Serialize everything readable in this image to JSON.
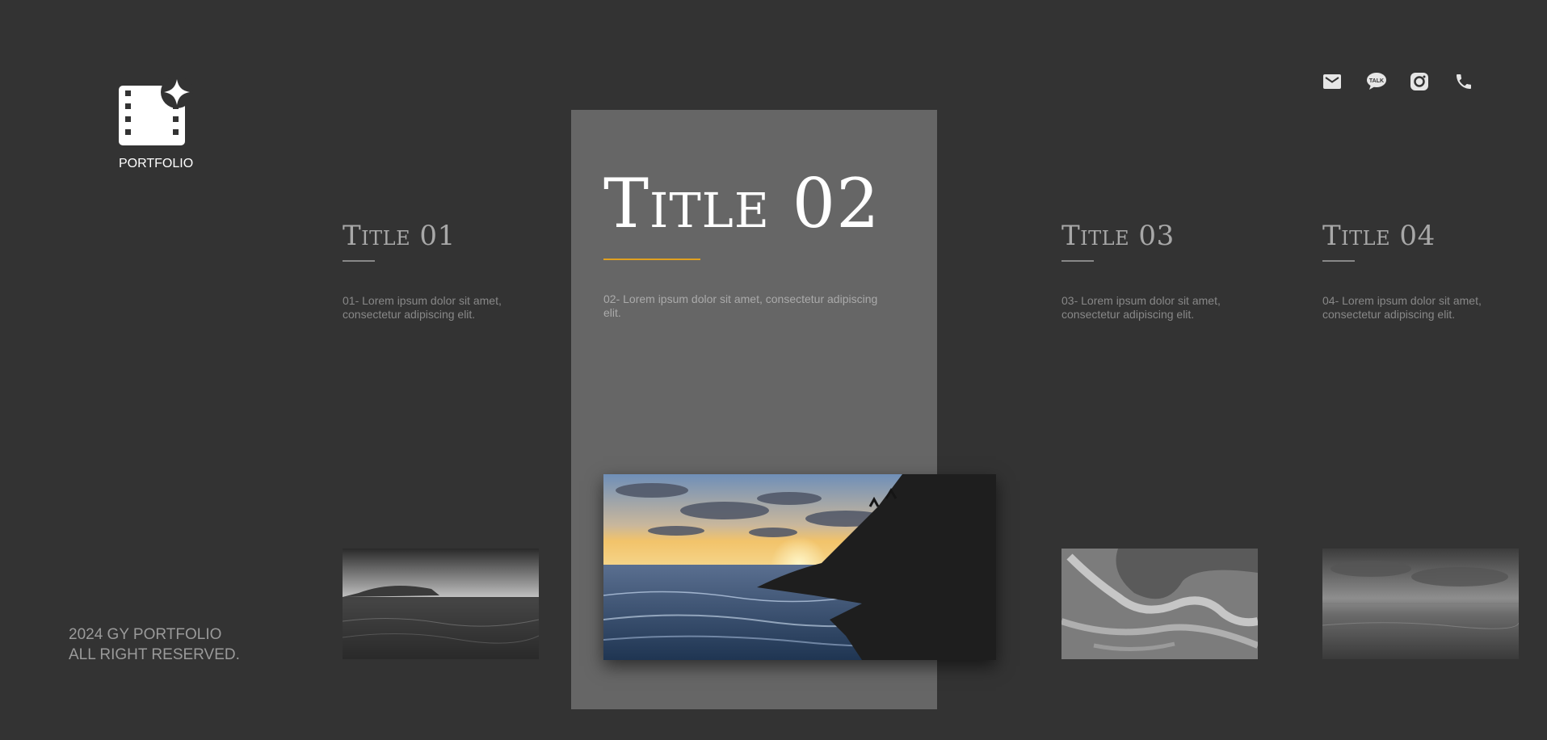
{
  "brand": {
    "label": "PORTFOLIO",
    "icon": "film-sparkle-icon"
  },
  "social": [
    {
      "name": "mail-icon"
    },
    {
      "name": "kakaotalk-icon",
      "text": "TALK"
    },
    {
      "name": "instagram-icon"
    },
    {
      "name": "phone-icon"
    }
  ],
  "cards": [
    {
      "title": "Title 01",
      "desc": "01- Lorem ipsum dolor sit amet, consectetur adipiscing elit.",
      "active": false
    },
    {
      "title": "Title 02",
      "desc": "02- Lorem ipsum dolor sit amet, consectetur adipiscing elit.",
      "active": true
    },
    {
      "title": "Title 03",
      "desc": "03- Lorem ipsum dolor sit amet, consectetur adipiscing elit.",
      "active": false
    },
    {
      "title": "Title 04",
      "desc": "04- Lorem ipsum dolor sit amet, consectetur adipiscing elit.",
      "active": false
    }
  ],
  "footer": {
    "line1": "2024 GY PORTFOLIO",
    "line2": "ALL RIGHT RESERVED."
  },
  "colors": {
    "background": "#333333",
    "active_panel": "#666666",
    "accent": "#e0a020",
    "text_muted": "#888888"
  }
}
